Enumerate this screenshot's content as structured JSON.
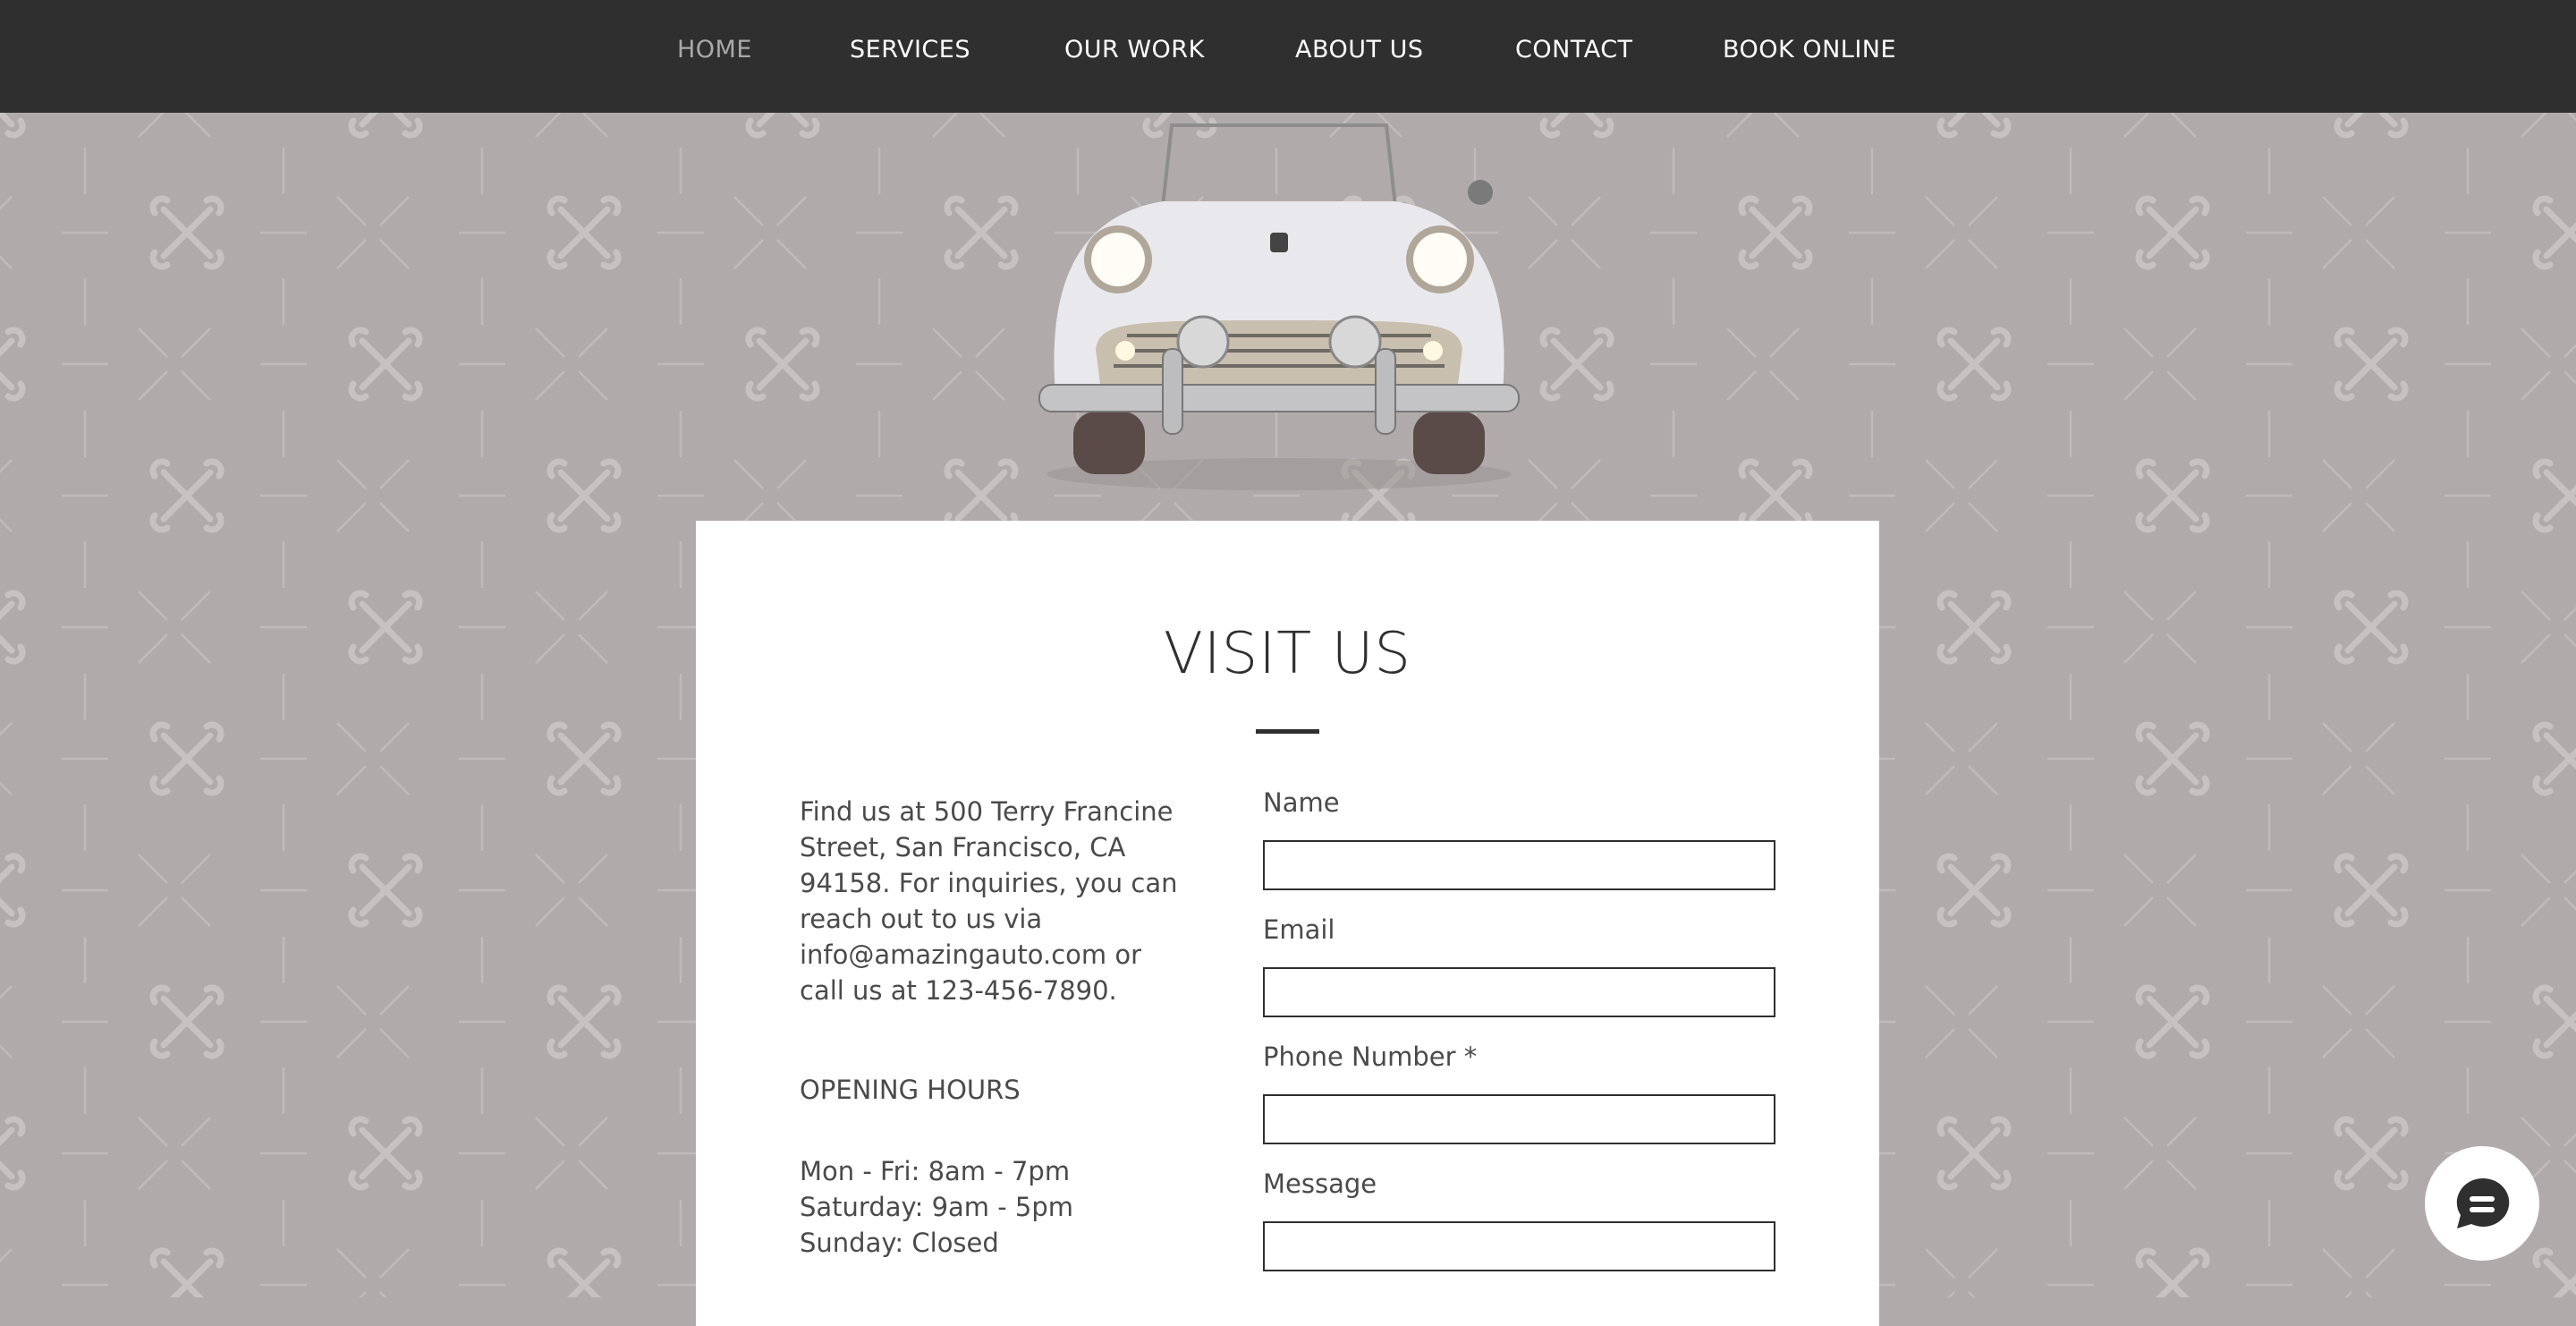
{
  "nav": {
    "items": [
      {
        "label": "HOME",
        "active": true
      },
      {
        "label": "SERVICES"
      },
      {
        "label": "OUR WORK"
      },
      {
        "label": "ABOUT US"
      },
      {
        "label": "CONTACT"
      },
      {
        "label": "BOOK ONLINE"
      }
    ]
  },
  "hero": {
    "image": "white-vintage-convertible-car"
  },
  "visit": {
    "title": "VISIT US",
    "info": "Find us at 500 Terry Francine Street, San Francisco, CA 94158. For inquiries, you can reach out to us via info@amazingauto.com or call us at 123-456-7890.",
    "hours_heading": "OPENING HOURS",
    "hours": [
      "Mon - Fri: 8am - 7pm",
      "Saturday: 9am - 5pm",
      "Sunday: Closed"
    ]
  },
  "form": {
    "fields": [
      {
        "label": "Name",
        "value": ""
      },
      {
        "label": "Email",
        "value": ""
      },
      {
        "label": "Phone Number *",
        "value": ""
      },
      {
        "label": "Message",
        "value": ""
      }
    ]
  },
  "chat": {
    "icon": "chat-bubble-icon"
  },
  "colors": {
    "nav_bg": "#2f2f2f",
    "page_bg": "#b0abaa",
    "text": "#4a4a4a",
    "active_nav": "#a9a9a9"
  }
}
